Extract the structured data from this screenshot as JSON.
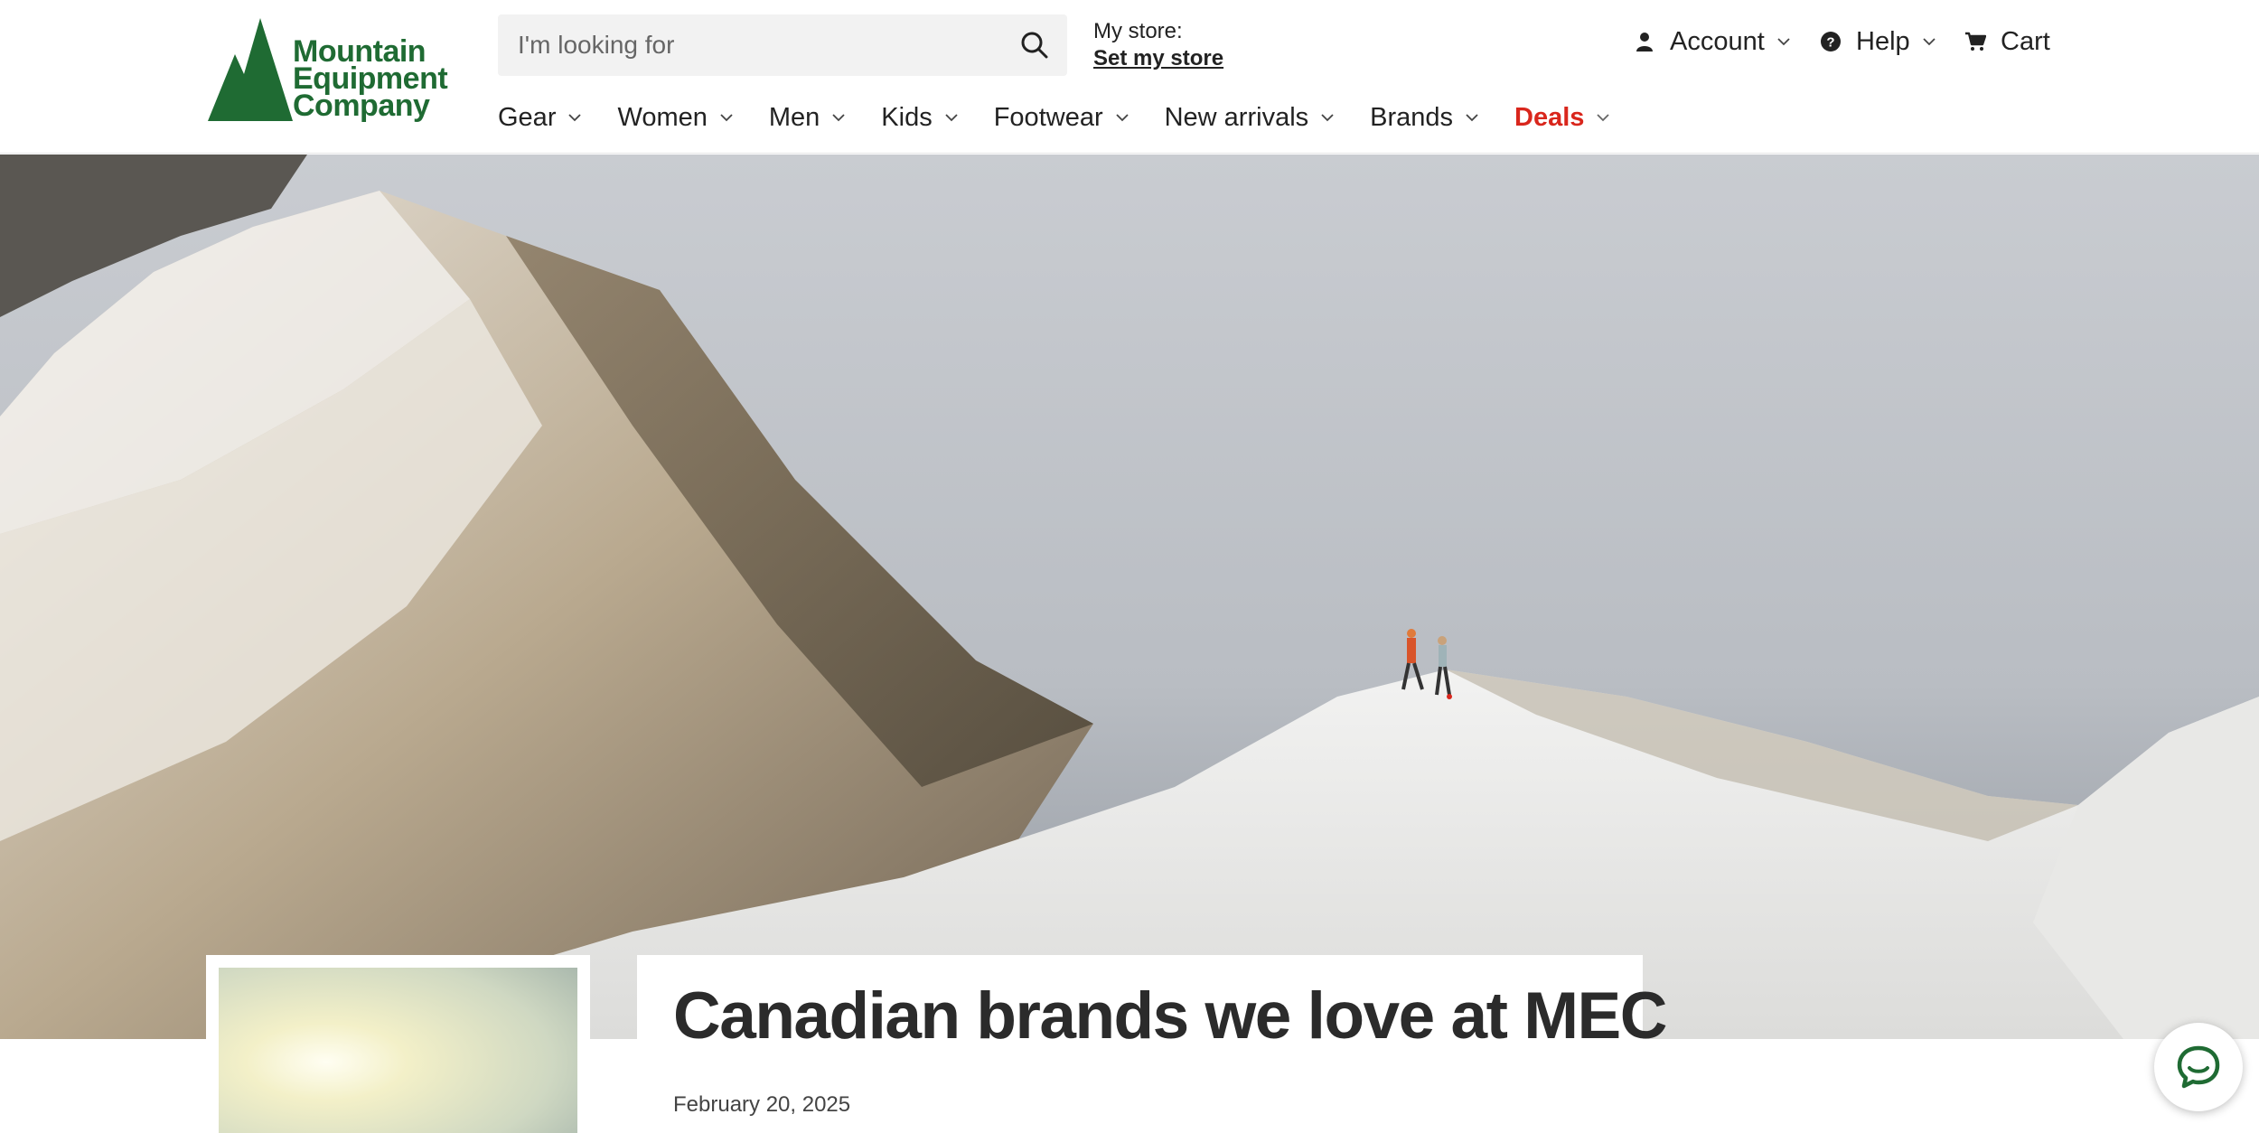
{
  "logo": {
    "line1": "Mountain",
    "line2": "Equipment",
    "line3": "Company",
    "icon": "mountain-logo-icon",
    "color": "#1f6b33"
  },
  "search": {
    "placeholder": "I'm looking for",
    "value": "",
    "icon": "search-icon"
  },
  "store": {
    "label": "My store:",
    "link": "Set my store"
  },
  "utility": {
    "account": "Account",
    "help": "Help",
    "cart": "Cart"
  },
  "nav": {
    "items": [
      "Gear",
      "Women",
      "Men",
      "Kids",
      "Footwear",
      "New arrivals",
      "Brands"
    ],
    "deals": "Deals",
    "deals_color": "#d9261c"
  },
  "article": {
    "title": "Canadian brands we love at MEC",
    "date": "February 20, 2025"
  },
  "chat": {
    "icon": "chat-icon",
    "color": "#1f6b33"
  }
}
